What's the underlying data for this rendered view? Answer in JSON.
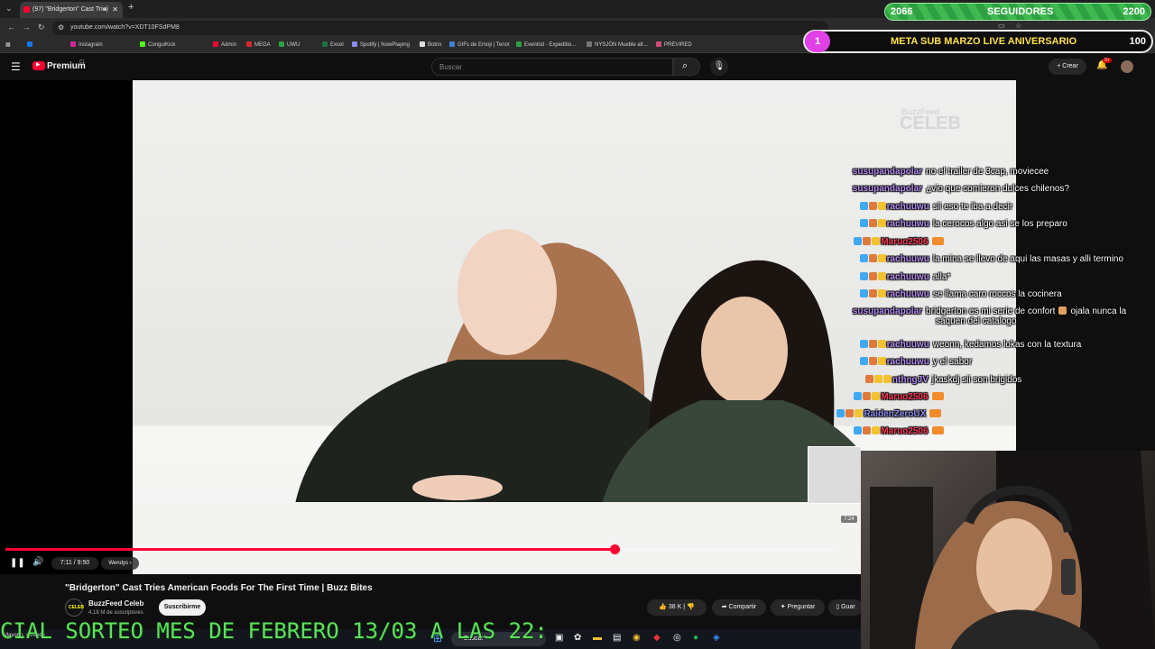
{
  "browser": {
    "tab_title": "(97) \"Bridgerton\" Cast Trie",
    "url": "youtube.com/watch?v=XDT10FSdPM8",
    "bookmarks": [
      "Instagram",
      "ConguiKick",
      "Admin",
      "MEGA",
      "UWU",
      "Excel",
      "Spotify | NowPlaying",
      "Botrix",
      "GIFs de Emoji | Tenor",
      "Eventrid - Expeditio...",
      "NYSJÓN Mueble alt...",
      "PREVIRED"
    ]
  },
  "overlay": {
    "followers_current": "2066",
    "followers_label": "SEGUIDORES",
    "followers_goal": "2200",
    "meta_badge": "1",
    "meta_label": "META SUB MARZO LIVE ANIVERSARIO",
    "meta_value": "100",
    "ticker": "CIAL SORTEO MES DE FEBRERO 13/03 A LAS 22:"
  },
  "youtube": {
    "logo": "Premium",
    "country": "CL",
    "search_placeholder": "Buscar",
    "create_label": "Crear",
    "notifications": "9+",
    "watermark_top": "BuzzFeed",
    "watermark_bottom": "CELEB"
  },
  "player": {
    "time": "7:11 / 9:50",
    "chapter": "Wendys",
    "thumb_time": "7:24",
    "progress": 0.73
  },
  "video": {
    "title": "\"Bridgerton\" Cast Tries American Foods For The First Time | Buzz Bites",
    "channel": "BuzzFeed Celeb",
    "subscribers": "4,18 M de suscriptores",
    "subscribe_label": "Suscribirme",
    "likes": "38 K",
    "share_label": "Compartir",
    "ask_label": "Preguntar",
    "save_label": "Guar"
  },
  "chat": [
    {
      "user": "susupandapolar",
      "text": "no el trailer de 3cap, moviecee",
      "color": "#b48cf0",
      "icons": []
    },
    {
      "user": "susupandapolar",
      "text": "¿vio que comieron dulces chilenos?",
      "color": "#b48cf0",
      "icons": []
    },
    {
      "user": "rachuuwu",
      "text": "sii eso te iba a decir",
      "color": "#b48cf0",
      "icons": [
        "#3fa9f5",
        "#e07a3a",
        "#f2c230"
      ]
    },
    {
      "user": "rachuuwu",
      "text": "la cerocos algo asi se los preparo",
      "color": "#b48cf0",
      "icons": [
        "#3fa9f5",
        "#e07a3a",
        "#f2c230"
      ]
    },
    {
      "user": "Maruo2506",
      "text": "",
      "color": "#ff3c5a",
      "icons": [
        "#3fa9f5",
        "#e07a3a",
        "#f2c230"
      ]
    },
    {
      "user": "rachuuwu",
      "text": "la mina se llevo de aqui las masas y alli termino",
      "color": "#b48cf0",
      "icons": [
        "#3fa9f5",
        "#e07a3a",
        "#f2c230"
      ]
    },
    {
      "user": "rachuuwu",
      "text": "alla*",
      "color": "#b48cf0",
      "icons": [
        "#3fa9f5",
        "#e07a3a",
        "#f2c230"
      ]
    },
    {
      "user": "rachuuwu",
      "text": "se llama caro roccos la cocinera",
      "color": "#b48cf0",
      "icons": [
        "#3fa9f5",
        "#e07a3a",
        "#f2c230"
      ]
    },
    {
      "user": "susupandapolar",
      "text": "bridgerton es mi serie de confort",
      "extra": "ojala nunca la",
      "line2": "saquen del catalogo",
      "color": "#b48cf0",
      "icons": []
    },
    {
      "user": "rachuuwu",
      "text": "weonn, kedamos lokas con la textura",
      "color": "#b48cf0",
      "icons": [
        "#3fa9f5",
        "#e07a3a",
        "#f2c230"
      ]
    },
    {
      "user": "rachuuwu",
      "text": "y el sabor",
      "color": "#b48cf0",
      "icons": [
        "#3fa9f5",
        "#e07a3a",
        "#f2c230"
      ]
    },
    {
      "user": "nthngJV",
      "text": "jkaskdj sii son brigidos",
      "color": "#b48cf0",
      "icons": [
        "#e07a3a",
        "#f2c230",
        "#f2c230"
      ]
    },
    {
      "user": "Maruo2506",
      "text": "",
      "color": "#ff3c5a",
      "icons": [
        "#3fa9f5",
        "#e07a3a",
        "#f2c230"
      ]
    },
    {
      "user": "RaidenZeroUX",
      "text": "",
      "color": "#8c8cf0",
      "icons": [
        "#3fa9f5",
        "#e07a3a",
        "#f2c230"
      ]
    },
    {
      "user": "Maruo2506",
      "text": "",
      "color": "#ff3c5a",
      "icons": [
        "#3fa9f5",
        "#e07a3a",
        "#f2c230"
      ]
    }
  ],
  "taskbar": {
    "search": "Buscar",
    "weather": "Mayorm. soleado"
  }
}
